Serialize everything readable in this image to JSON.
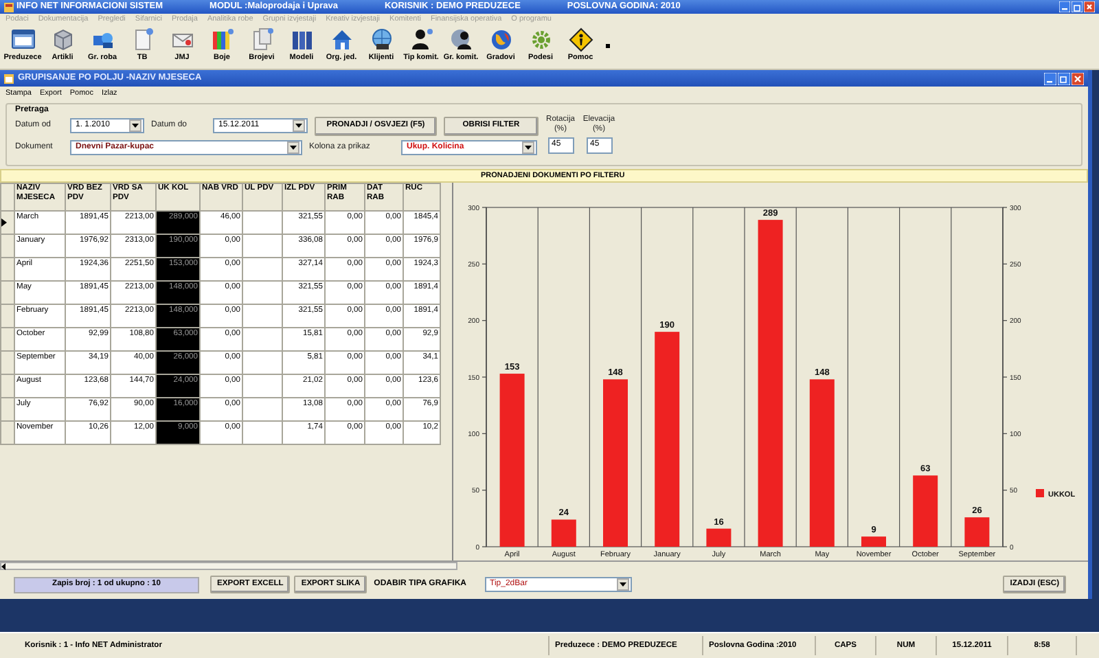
{
  "window": {
    "title_parts": [
      "INFO NET INFORMACIONI SISTEM",
      "MODUL :Maloprodaja i Uprava",
      "KORISNIK : DEMO PREDUZECE",
      "POSLOVNA GODINA: 2010"
    ]
  },
  "main_menu": [
    "Podaci",
    "Dokumentacija",
    "Pregledi",
    "Sifarnici",
    "Prodaja",
    "Analitika robe",
    "Grupni izvjestaji",
    "Kreativ izvjestaji",
    "Komitenti",
    "Finansijska operativa",
    "O programu"
  ],
  "toolbar": [
    "Preduzece",
    "Artikli",
    "Gr. roba",
    "TB",
    "JMJ",
    "Boje",
    "Brojevi",
    "Modeli",
    "Org. jed.",
    "Klijenti",
    "Tip komit.",
    "Gr. komit.",
    "Gradovi",
    "Podesi",
    "Pomoc"
  ],
  "subwindow": {
    "title": "GRUPISANJE PO POLJU -NAZIV MJESECA",
    "menu": [
      "Stampa",
      "Export",
      "Pomoc",
      "Izlaz"
    ]
  },
  "filter": {
    "title": "Pretraga",
    "date_from": {
      "label": "Datum od",
      "value": "1. 1.2010"
    },
    "date_to": {
      "label": "Datum do",
      "value": "15.12.2011"
    },
    "find_button": "PRONADJI / OSVJEZI (F5)",
    "clear_button": "OBRISI FILTER",
    "rotation": {
      "label": "Rotacija (%)",
      "value": "45"
    },
    "elevation": {
      "label": "Elevacija (%)",
      "value": "45"
    },
    "document": {
      "label": "Dokument",
      "value": "Dnevni Pazar-kupac"
    },
    "column": {
      "label": "Kolona za prikaz",
      "value": "Ukup. Kolicina"
    }
  },
  "results_header": "PRONADJENI DOKUMENTI PO FILTERU",
  "table": {
    "columns": [
      {
        "label": "NAZIV MJESECA",
        "selected": false
      },
      {
        "label": "VRD BEZ PDV",
        "selected": false
      },
      {
        "label": "VRD SA PDV",
        "selected": false
      },
      {
        "label": "UK KOL",
        "selected": true
      },
      {
        "label": "NAB VRD",
        "selected": false
      },
      {
        "label": "UL PDV",
        "selected": false
      },
      {
        "label": "IZL PDV",
        "selected": false
      },
      {
        "label": "PRIM RAB",
        "selected": false
      },
      {
        "label": "DAT RAB",
        "selected": false
      },
      {
        "label": "RUC",
        "selected": false
      }
    ],
    "rows": [
      {
        "selected": true,
        "cells": [
          "March",
          "1891,45",
          "2213,00",
          "289,000",
          "46,00",
          null,
          "321,55",
          "0,00",
          "0,00",
          "1845,4"
        ]
      },
      {
        "selected": false,
        "cells": [
          "January",
          "1976,92",
          "2313,00",
          "190,000",
          "0,00",
          null,
          "336,08",
          "0,00",
          "0,00",
          "1976,9"
        ]
      },
      {
        "selected": false,
        "cells": [
          "April",
          "1924,36",
          "2251,50",
          "153,000",
          "0,00",
          null,
          "327,14",
          "0,00",
          "0,00",
          "1924,3"
        ]
      },
      {
        "selected": false,
        "cells": [
          "May",
          "1891,45",
          "2213,00",
          "148,000",
          "0,00",
          null,
          "321,55",
          "0,00",
          "0,00",
          "1891,4"
        ]
      },
      {
        "selected": false,
        "cells": [
          "February",
          "1891,45",
          "2213,00",
          "148,000",
          "0,00",
          null,
          "321,55",
          "0,00",
          "0,00",
          "1891,4"
        ]
      },
      {
        "selected": false,
        "cells": [
          "October",
          "92,99",
          "108,80",
          "63,000",
          "0,00",
          null,
          "15,81",
          "0,00",
          "0,00",
          "92,9"
        ]
      },
      {
        "selected": false,
        "cells": [
          "September",
          "34,19",
          "40,00",
          "26,000",
          "0,00",
          null,
          "5,81",
          "0,00",
          "0,00",
          "34,1"
        ]
      },
      {
        "selected": false,
        "cells": [
          "August",
          "123,68",
          "144,70",
          "24,000",
          "0,00",
          null,
          "21,02",
          "0,00",
          "0,00",
          "123,6"
        ]
      },
      {
        "selected": false,
        "cells": [
          "July",
          "76,92",
          "90,00",
          "16,000",
          "0,00",
          null,
          "13,08",
          "0,00",
          "0,00",
          "76,9"
        ]
      },
      {
        "selected": false,
        "cells": [
          "November",
          "10,26",
          "12,00",
          "9,000",
          "0,00",
          null,
          "1,74",
          "0,00",
          "0,00",
          "10,2"
        ]
      }
    ]
  },
  "chart_data": {
    "type": "bar",
    "categories": [
      "April",
      "August",
      "February",
      "January",
      "July",
      "March",
      "May",
      "November",
      "October",
      "September"
    ],
    "series": [
      {
        "name": "UKKOL",
        "color": "#ee2222",
        "values": [
          153,
          24,
          148,
          190,
          16,
          289,
          148,
          9,
          63,
          26
        ]
      }
    ],
    "ylim": [
      0,
      300
    ],
    "yticks": [
      0,
      50,
      100,
      150,
      200,
      250,
      300
    ],
    "y2lim": [
      0,
      300
    ],
    "y2ticks": [
      0,
      50,
      100,
      150,
      200,
      250,
      300
    ],
    "data_labels": true
  },
  "footer": {
    "record": "Zapis broj : 1 od ukupno : 10",
    "export_excel": "EXPORT EXCELL",
    "export_image": "EXPORT SLIKA",
    "chart_type_label": "ODABIR TIPA GRAFIKA",
    "chart_type": "Tip_2dBar",
    "exit": "IZADJI (ESC)"
  },
  "status_bar": [
    "Korisnik : 1 - Info NET Administrator",
    "Preduzece : DEMO PREDUZECE",
    "Poslovna Godina :2010",
    "CAPS",
    "NUM",
    "15.12.2011",
    "8:58"
  ]
}
